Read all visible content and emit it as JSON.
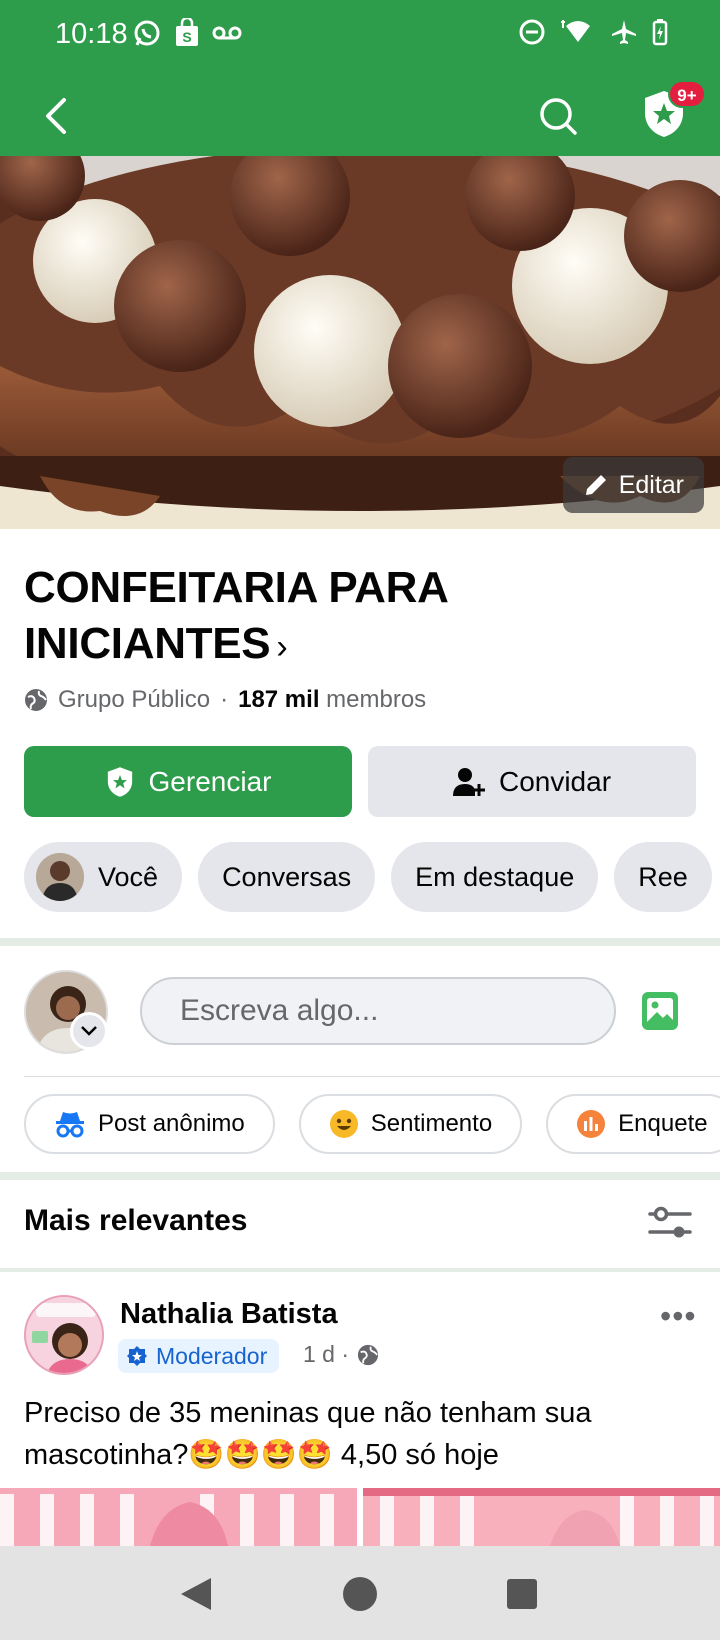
{
  "status_bar": {
    "time": "10:18"
  },
  "header": {
    "badge": "9+"
  },
  "cover": {
    "edit_label": "Editar"
  },
  "group": {
    "title": "CONFEITARIA PARA INICIANTES",
    "privacy": "Grupo Público",
    "separator": "·",
    "member_count": "187 mil",
    "member_label": "membros"
  },
  "actions": {
    "manage_label": "Gerenciar",
    "invite_label": "Convidar"
  },
  "chips": [
    {
      "label": "Você"
    },
    {
      "label": "Conversas"
    },
    {
      "label": "Em destaque"
    },
    {
      "label": "Ree"
    }
  ],
  "composer": {
    "placeholder": "Escreva algo..."
  },
  "post_options": [
    {
      "label": "Post anônimo",
      "icon": "incognito-icon",
      "color": "#1877f2"
    },
    {
      "label": "Sentimento",
      "icon": "smiley-icon",
      "color": "#f7b928"
    },
    {
      "label": "Enquete",
      "icon": "poll-icon",
      "color": "#f5833b"
    }
  ],
  "feed": {
    "sort_label": "Mais relevantes"
  },
  "post": {
    "author": "Nathalia Batista",
    "role": "Moderador",
    "time": "1 d ·",
    "text": "Preciso de 35 meninas que não tenham sua mascotinha?🤩🤩🤩🤩 4,50 só hoje"
  },
  "colors": {
    "brand_green": "#2d9c4b",
    "badge_red": "#e41e3f",
    "chip_gray": "#e4e6eb",
    "moderator_blue": "#1763cf"
  }
}
